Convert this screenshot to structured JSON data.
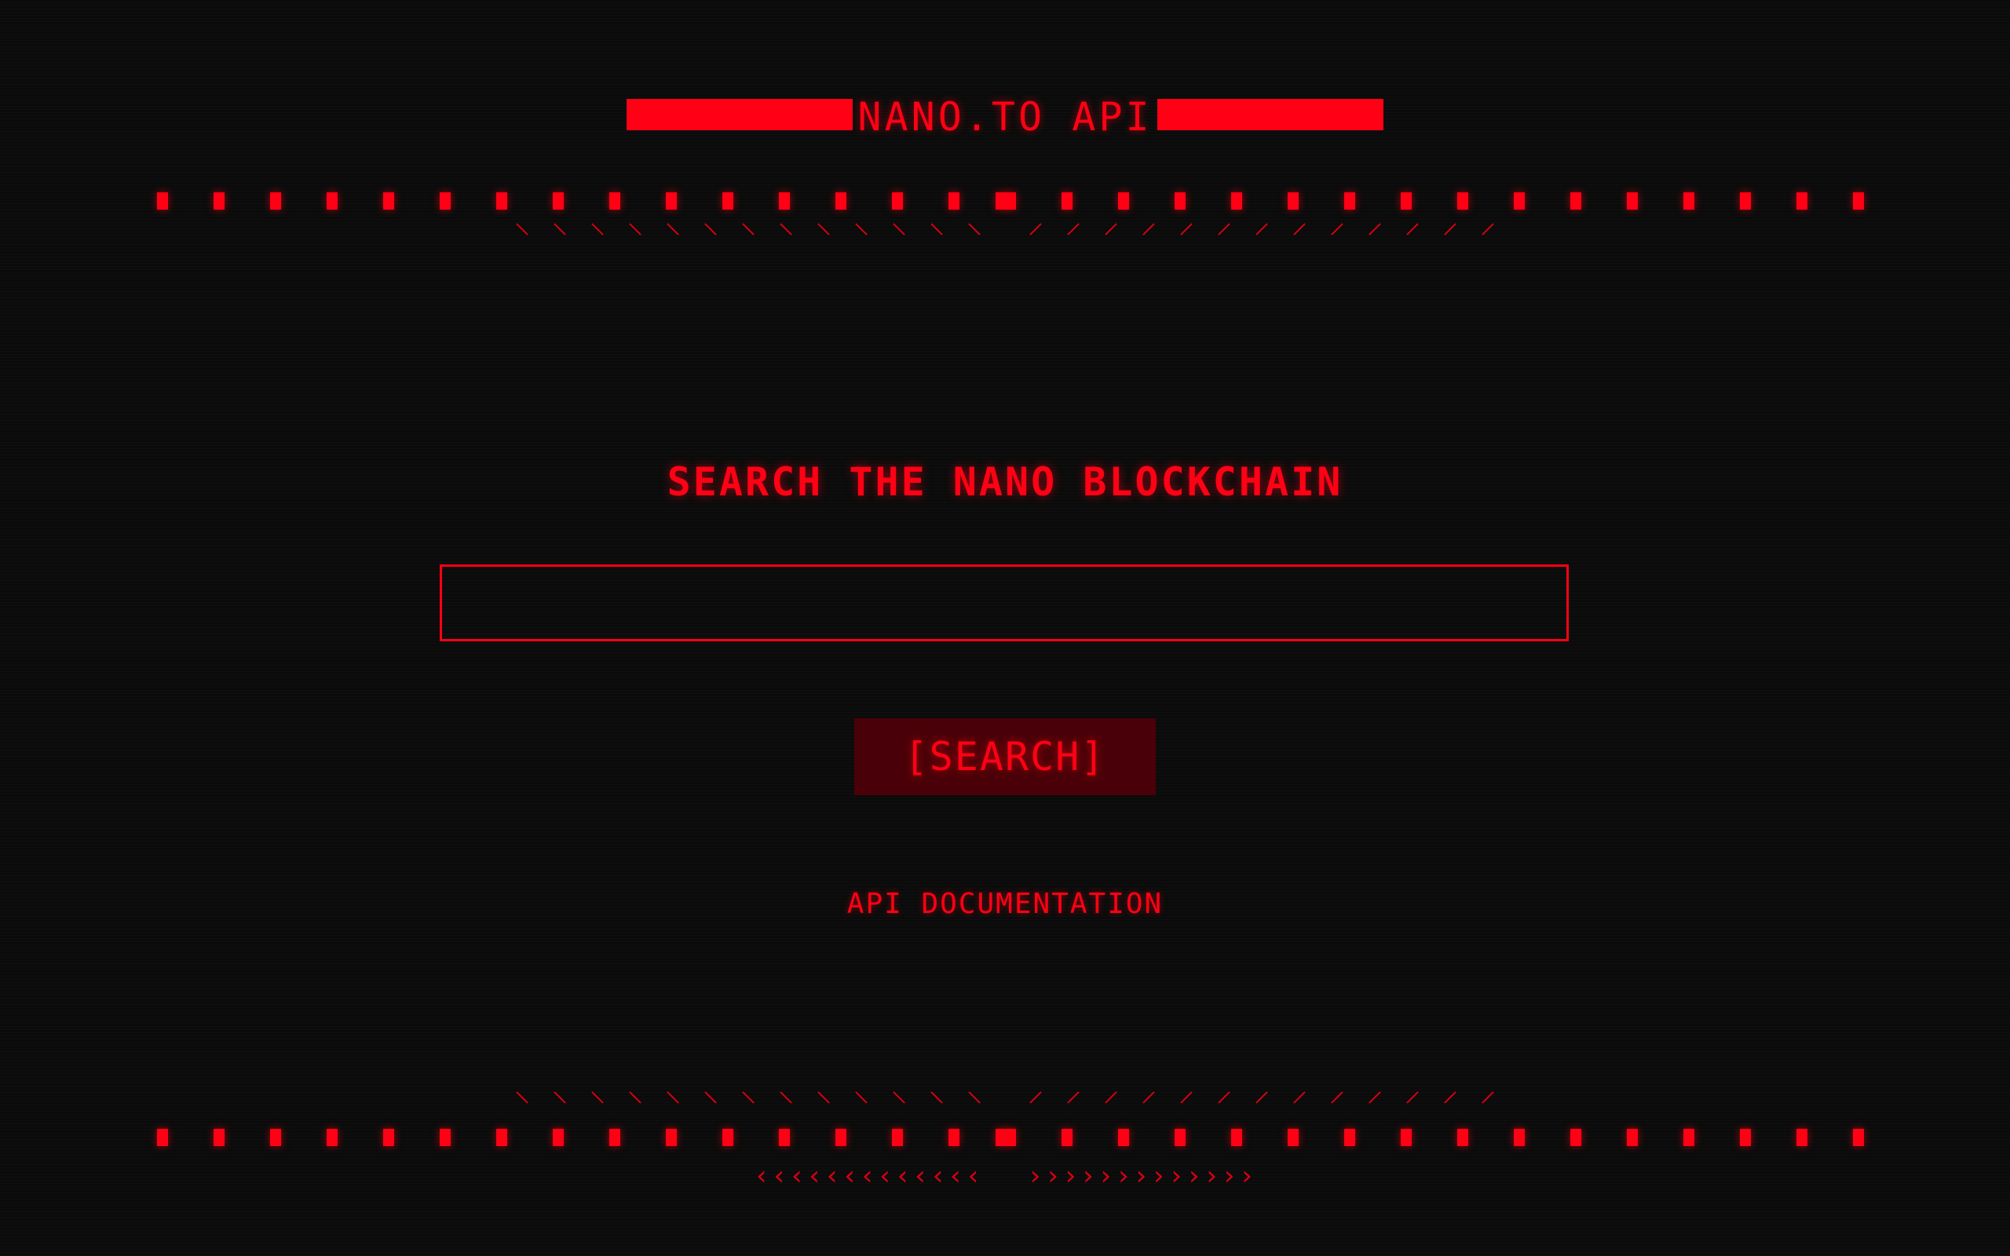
{
  "header": {
    "title": "NANO.TO API"
  },
  "main": {
    "heading": "SEARCH THE NANO BLOCKCHAIN",
    "search_value": "",
    "search_placeholder": "",
    "search_button_label": "[SEARCH]",
    "docs_link_label": "API DOCUMENTATION"
  },
  "decor": {
    "chevrons_left": "‹‹‹‹‹‹‹‹‹‹‹‹‹",
    "chevrons_right": "›››››››››››››"
  },
  "colors": {
    "accent": "#ff0014",
    "background": "#0b0b0b",
    "button_bg": "#4a0008"
  }
}
